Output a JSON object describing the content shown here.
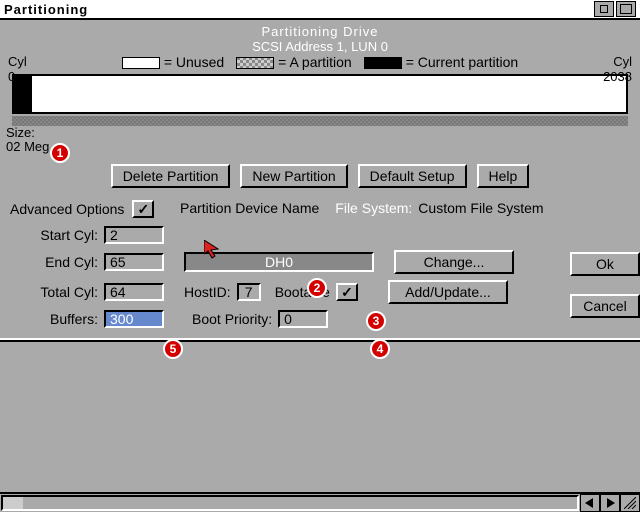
{
  "window": {
    "title": "Partitioning"
  },
  "header": {
    "title": "Partitioning Drive",
    "subtitle": "SCSI Address 1, LUN 0"
  },
  "cyl": {
    "left_label": "Cyl",
    "left_value": "0",
    "right_label": "Cyl",
    "right_value": "2038"
  },
  "legend": {
    "unused": "= Unused",
    "apartition": "= A partition",
    "current": "= Current partition"
  },
  "size": {
    "label": "Size:",
    "value": "02 Meg"
  },
  "buttons": {
    "delete": "Delete Partition",
    "new": "New Partition",
    "default": "Default Setup",
    "help": "Help",
    "change": "Change...",
    "addupdate": "Add/Update...",
    "ok": "Ok",
    "cancel": "Cancel"
  },
  "advanced": {
    "label": "Advanced Options",
    "checked": "✓"
  },
  "device": {
    "label": "Partition Device Name",
    "value": "DH0",
    "fs_label": "File System:",
    "fs_value": "Custom File System"
  },
  "fields": {
    "startcyl_label": "Start Cyl:",
    "startcyl": "2",
    "endcyl_label": "End Cyl:",
    "endcyl": "65",
    "totalcyl_label": "Total Cyl:",
    "totalcyl": "64",
    "buffers_label": "Buffers:",
    "buffers": "300",
    "hostid_label": "HostID:",
    "hostid": "7",
    "bootable_label": "Bootable",
    "bootable_checked": "✓",
    "bootpriority_label": "Boot Priority:",
    "bootpriority": "0"
  },
  "markers": {
    "m1": "1",
    "m2": "2",
    "m3": "3",
    "m4": "4",
    "m5": "5"
  }
}
